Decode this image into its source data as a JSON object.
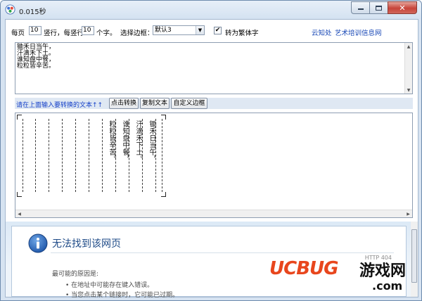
{
  "window": {
    "title": "0.015秒"
  },
  "settings": {
    "per_page_label": "每页",
    "per_page_value": "10",
    "columns_label": "竖行，每竖行",
    "chars_per_col_value": "10",
    "chars_label": "个字。",
    "border_label": "选择边框：",
    "border_selected": "默认3",
    "traditional_label": "转为繁体字",
    "traditional_checked": "✔",
    "links": [
      "云知处",
      "艺术培训信息网"
    ]
  },
  "input_text": {
    "lines": [
      "锄禾日当午，",
      "汗滴禾下土。",
      "谁知盘中餐，",
      "粒粒皆辛苦。"
    ]
  },
  "actions": {
    "hint": "请在上面输入要转换的文本↑↑",
    "convert_button": "点击转换",
    "copy_button": "复制文本",
    "border_button": "自定义边框"
  },
  "preview": {
    "columns": [
      "锄禾日当午，",
      "汗滴禾下土。",
      "谁知盘中餐，",
      "粒粒皆辛苦。"
    ]
  },
  "web_error": {
    "title": "无法找到该网页",
    "code": "HTTP 404",
    "reason_label": "最可能的原因是:",
    "bullets": [
      "在地址中可能存在键入错误。",
      "当您点击某个链接时，它可能已过期。"
    ]
  },
  "watermark": {
    "brand": "UCBUG",
    "game": "游戏网",
    "domain": ".com"
  },
  "colors": {
    "link": "#1646b5",
    "hint": "#1641c8",
    "error_title": "#1e4a87",
    "watermark": "#e8461d"
  }
}
